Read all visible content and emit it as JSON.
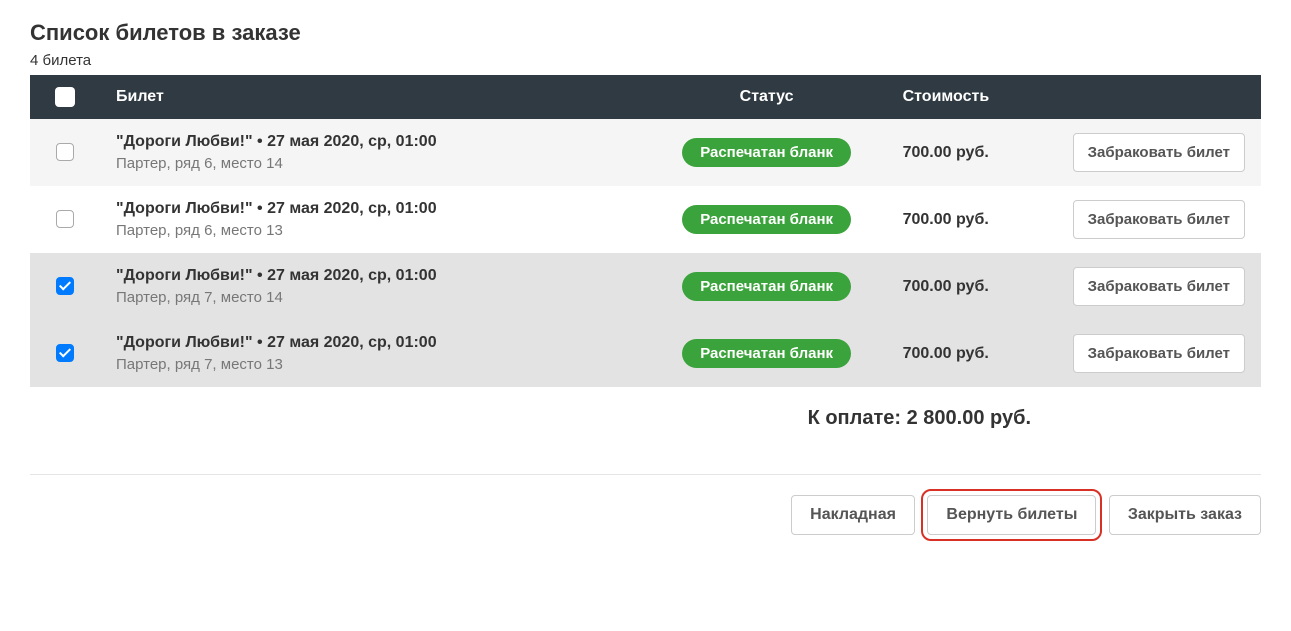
{
  "section_title": "Список билетов в заказе",
  "ticket_count_label": "4 билета",
  "columns": {
    "ticket": "Билет",
    "status": "Статус",
    "price": "Стоимость"
  },
  "tickets": [
    {
      "title": "\"Дороги Любви!\" • 27 мая 2020, ср, 01:00",
      "seat": "Партер, ряд 6, место 14",
      "status": "Распечатан бланк",
      "price": "700.00 руб.",
      "reject_label": "Забраковать билет",
      "checked": false,
      "row_class": "row-odd"
    },
    {
      "title": "\"Дороги Любви!\" • 27 мая 2020, ср, 01:00",
      "seat": "Партер, ряд 6, место 13",
      "status": "Распечатан бланк",
      "price": "700.00 руб.",
      "reject_label": "Забраковать билет",
      "checked": false,
      "row_class": "row-even"
    },
    {
      "title": "\"Дороги Любви!\" • 27 мая 2020, ср, 01:00",
      "seat": "Партер, ряд 7, место 14",
      "status": "Распечатан бланк",
      "price": "700.00 руб.",
      "reject_label": "Забраковать билет",
      "checked": true,
      "row_class": "row-selected"
    },
    {
      "title": "\"Дороги Любви!\" • 27 мая 2020, ср, 01:00",
      "seat": "Партер, ряд 7, место 13",
      "status": "Распечатан бланк",
      "price": "700.00 руб.",
      "reject_label": "Забраковать билет",
      "checked": true,
      "row_class": "row-selected"
    }
  ],
  "total_label": "К оплате: 2 800.00 руб.",
  "footer": {
    "invoice": "Накладная",
    "return_tickets": "Вернуть билеты",
    "close_order": "Закрыть заказ"
  }
}
